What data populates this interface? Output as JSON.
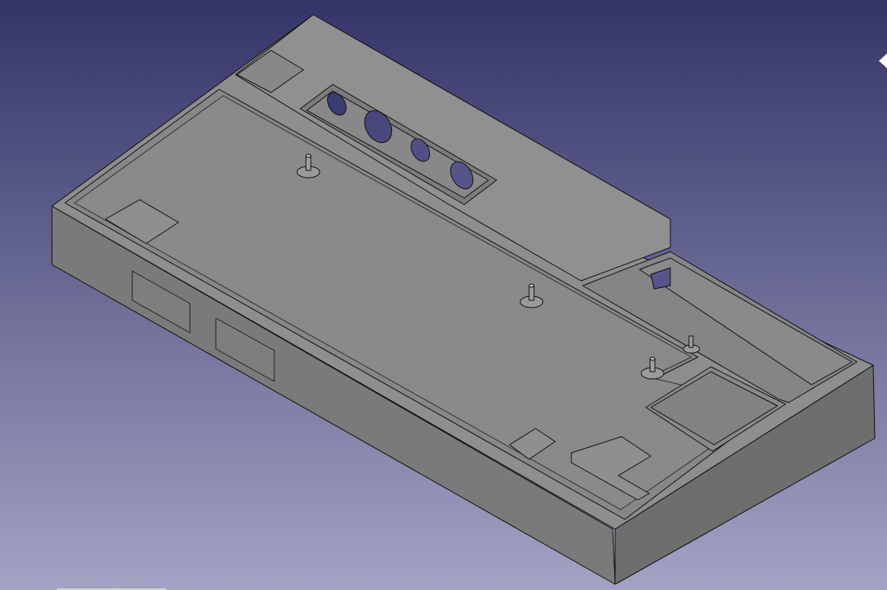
{
  "viewport": {
    "name": "3D View",
    "background_top": "#343469",
    "background_bottom": "#a3a3c4"
  },
  "model": {
    "face_color": "#8c8c8c",
    "face_light": "#969696",
    "face_dark": "#6f6f6f",
    "edge_color": "#000000"
  },
  "navigation_cube": {
    "icon": "navigation-cube-arrow-icon",
    "color": "#ffffff"
  }
}
